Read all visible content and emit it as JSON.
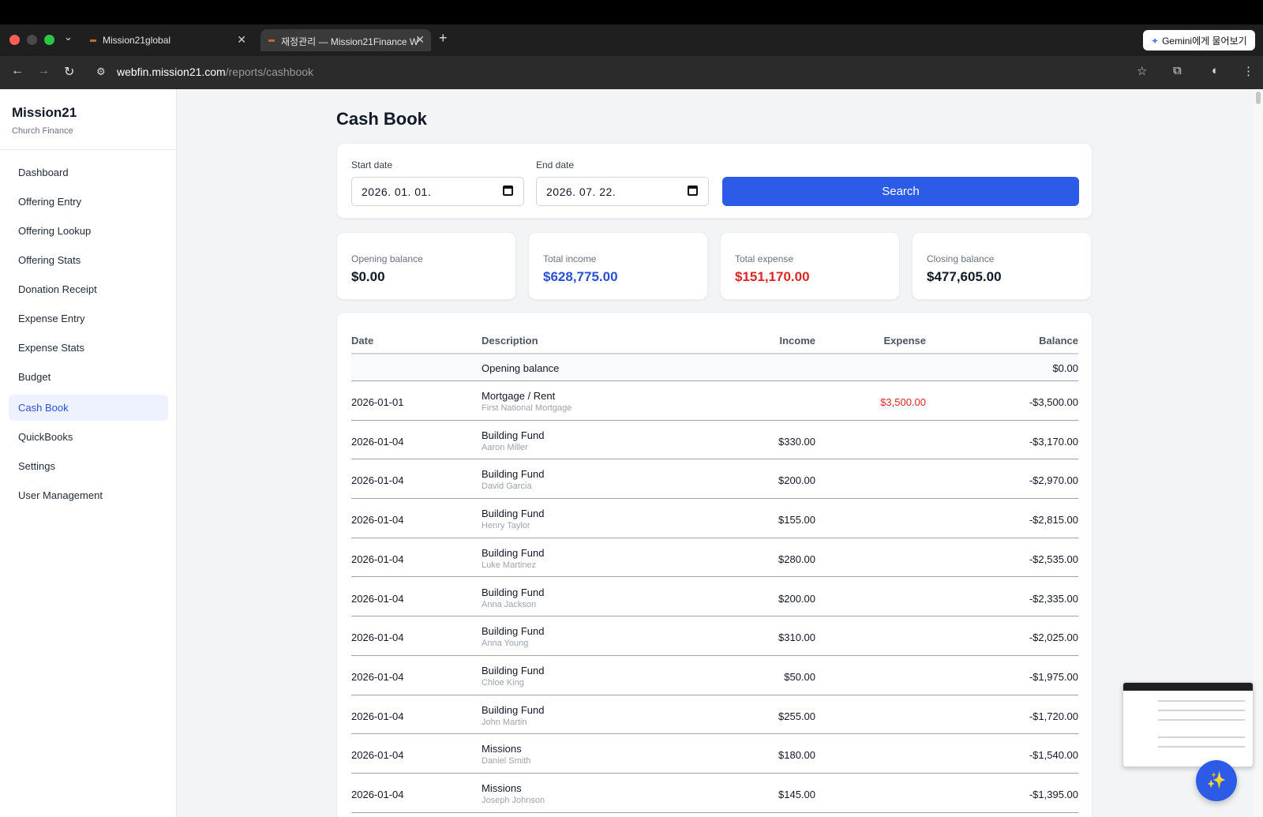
{
  "browser": {
    "tabs": [
      {
        "title": "Mission21global"
      },
      {
        "title": "재정관리 — Mission21Finance W"
      }
    ],
    "gemini_label": "Gemini에게 물어보기",
    "url_host": "webfin.mission21.com",
    "url_path": "/reports/cashbook"
  },
  "sidebar": {
    "brand": "Mission21",
    "subtitle": "Church Finance",
    "items": [
      {
        "label": "Dashboard"
      },
      {
        "label": "Offering Entry"
      },
      {
        "label": "Offering Lookup"
      },
      {
        "label": "Offering Stats"
      },
      {
        "label": "Donation Receipt"
      },
      {
        "label": "Expense Entry"
      },
      {
        "label": "Expense Stats"
      },
      {
        "label": "Budget"
      },
      {
        "label": "Cash Book",
        "active": true
      },
      {
        "label": "QuickBooks"
      },
      {
        "label": "Settings"
      },
      {
        "label": "User Management"
      }
    ]
  },
  "page": {
    "title": "Cash Book",
    "filters": {
      "start_label": "Start date",
      "start_value": "2026. 01. 01.",
      "end_label": "End date",
      "end_value": "2026. 07. 22.",
      "search_label": "Search"
    },
    "summary": [
      {
        "label": "Opening balance",
        "value": "$0.00"
      },
      {
        "label": "Total income",
        "value": "$628,775.00"
      },
      {
        "label": "Total expense",
        "value": "$151,170.00"
      },
      {
        "label": "Closing balance",
        "value": "$477,605.00"
      }
    ],
    "table": {
      "headers": {
        "date": "Date",
        "description": "Description",
        "income": "Income",
        "expense": "Expense",
        "balance": "Balance"
      },
      "opening": {
        "description": "Opening balance",
        "balance": "$0.00"
      },
      "rows": [
        {
          "date": "2026-01-01",
          "description": "Mortgage / Rent",
          "sub": "First National Mortgage",
          "income": "",
          "expense": "$3,500.00",
          "balance": "-$3,500.00"
        },
        {
          "date": "2026-01-04",
          "description": "Building Fund",
          "sub": "Aaron Miller",
          "income": "$330.00",
          "expense": "",
          "balance": "-$3,170.00"
        },
        {
          "date": "2026-01-04",
          "description": "Building Fund",
          "sub": "David Garcia",
          "income": "$200.00",
          "expense": "",
          "balance": "-$2,970.00"
        },
        {
          "date": "2026-01-04",
          "description": "Building Fund",
          "sub": "Henry Taylor",
          "income": "$155.00",
          "expense": "",
          "balance": "-$2,815.00"
        },
        {
          "date": "2026-01-04",
          "description": "Building Fund",
          "sub": "Luke Martinez",
          "income": "$280.00",
          "expense": "",
          "balance": "-$2,535.00"
        },
        {
          "date": "2026-01-04",
          "description": "Building Fund",
          "sub": "Anna Jackson",
          "income": "$200.00",
          "expense": "",
          "balance": "-$2,335.00"
        },
        {
          "date": "2026-01-04",
          "description": "Building Fund",
          "sub": "Anna Young",
          "income": "$310.00",
          "expense": "",
          "balance": "-$2,025.00"
        },
        {
          "date": "2026-01-04",
          "description": "Building Fund",
          "sub": "Chloe King",
          "income": "$50.00",
          "expense": "",
          "balance": "-$1,975.00"
        },
        {
          "date": "2026-01-04",
          "description": "Building Fund",
          "sub": "John Martin",
          "income": "$255.00",
          "expense": "",
          "balance": "-$1,720.00"
        },
        {
          "date": "2026-01-04",
          "description": "Missions",
          "sub": "Daniel Smith",
          "income": "$180.00",
          "expense": "",
          "balance": "-$1,540.00"
        },
        {
          "date": "2026-01-04",
          "description": "Missions",
          "sub": "Joseph Johnson",
          "income": "$145.00",
          "expense": "",
          "balance": "-$1,395.00"
        }
      ]
    }
  },
  "colors": {
    "accent": "#2c5be8",
    "income": "#2a4fd6",
    "expense": "#dc2626"
  }
}
